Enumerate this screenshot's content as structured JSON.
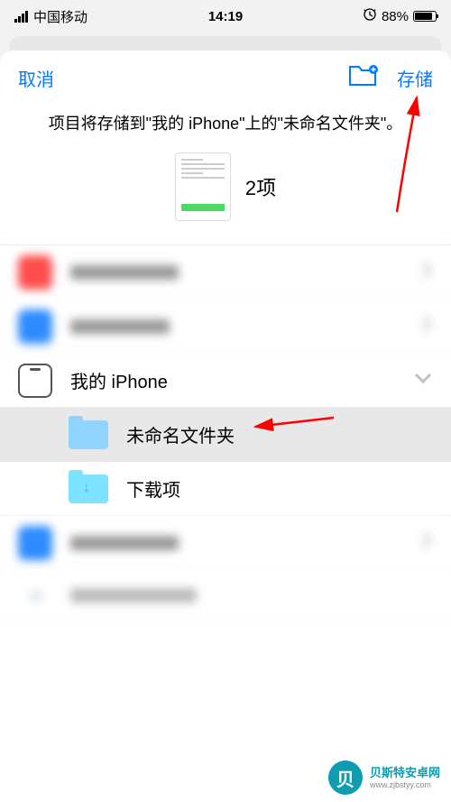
{
  "status_bar": {
    "carrier": "中国移动",
    "time": "14:19",
    "alarm_icon": "⏰",
    "battery_percent": "88%"
  },
  "modal": {
    "cancel_label": "取消",
    "save_label": "存储",
    "location_text": "项目将存储到\"我的 iPhone\"上的\"未命名文件夹\"。",
    "item_count": "2项"
  },
  "locations": {
    "my_iphone": "我的 iPhone",
    "unnamed_folder": "未命名文件夹",
    "downloads": "下载项"
  },
  "watermark": {
    "name": "贝斯特安卓网",
    "url": "www.zjbstyy.com"
  }
}
